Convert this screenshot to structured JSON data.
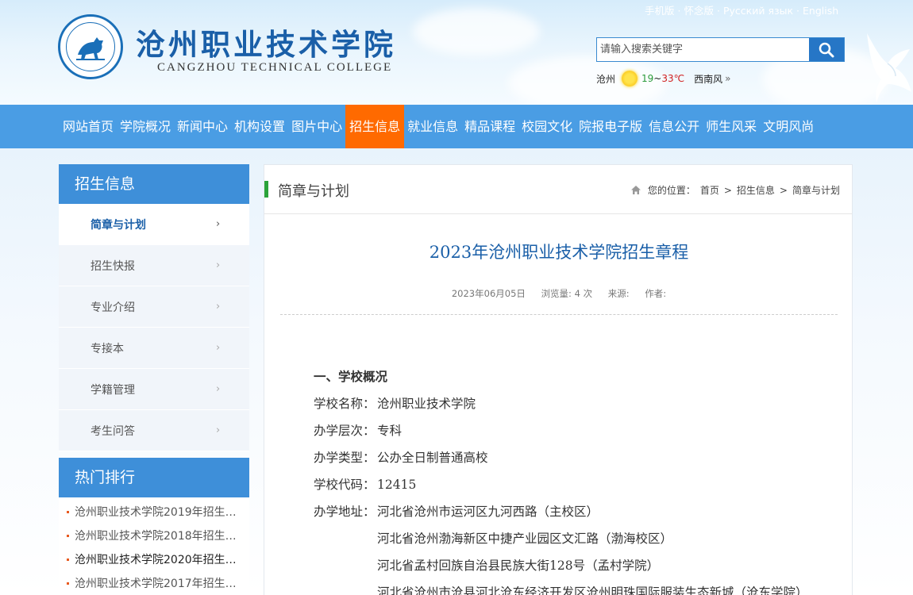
{
  "header": {
    "logo_cn": "沧州职业技术学院",
    "logo_en": "CANGZHOU TECHNICAL COLLEGE",
    "top_links": [
      "手机版",
      "怀念版",
      "Русский язык",
      "English"
    ],
    "search_placeholder": "请输入搜索关键字",
    "weather": {
      "city": "沧州",
      "low": "19",
      "sep": "~",
      "high": "33℃",
      "wind": "西南风"
    }
  },
  "nav": [
    "网站首页",
    "学院概况",
    "新闻中心",
    "机构设置",
    "图片中心",
    "招生信息",
    "就业信息",
    "精品课程",
    "校园文化",
    "院报电子版",
    "信息公开",
    "师生风采",
    "文明风尚"
  ],
  "sidebar": {
    "title": "招生信息",
    "items": [
      "简章与计划",
      "招生快报",
      "专业介绍",
      "专接本",
      "学籍管理",
      "考生问答"
    ]
  },
  "hot": {
    "title": "热门排行",
    "items": [
      "沧州职业技术学院2019年招生…",
      "沧州职业技术学院2018年招生…",
      "沧州职业技术学院2020年招生…",
      "沧州职业技术学院2017年招生…"
    ]
  },
  "main": {
    "section_title": "简章与计划",
    "breadcrumb": {
      "label": "您的位置：",
      "home": "首页",
      "sep": ">",
      "level1": "招生信息",
      "level2": "简章与计划"
    },
    "article_title": "2023年沧州职业技术学院招生章程",
    "meta": {
      "date": "2023年06月05日",
      "views": "浏览量: 4 次",
      "source": "来源:",
      "author": "作者:"
    },
    "content": {
      "heading": "一、学校概况",
      "rows": [
        {
          "label": "学校名称：",
          "value": "沧州职业技术学院"
        },
        {
          "label": "办学层次：",
          "value": "专科"
        },
        {
          "label": "办学类型：",
          "value": "公办全日制普通高校"
        },
        {
          "label": "学校代码：",
          "value": "12415"
        },
        {
          "label": "办学地址：",
          "value": "河北省沧州市运河区九河西路（主校区）"
        }
      ],
      "addresses": [
        "河北省沧州渤海新区中捷产业园区文汇路（渤海校区）",
        "河北省孟村回族自治县民族大街128号（孟村学院）",
        "河北省沧州市沧县河北沧东经济开发区沧州明珠国际服装生态新城（沧东学院）"
      ]
    }
  }
}
